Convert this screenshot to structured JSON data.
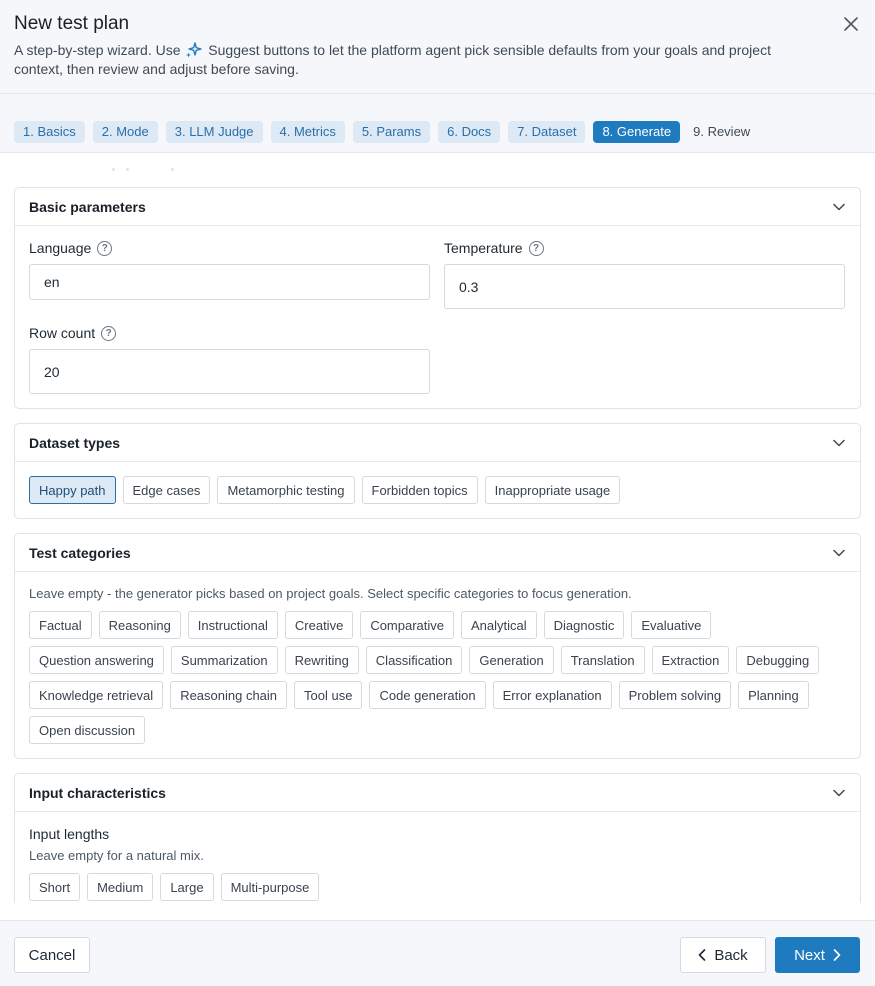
{
  "dialog": {
    "title": "New test plan",
    "subtitle_before": "A step-by-step wizard. Use",
    "subtitle_after": "Suggest buttons to let the platform agent pick sensible defaults from your goals and project context, then review and adjust before saving.",
    "sparkle_icon": "sparkle-icon",
    "close_icon": "close-icon"
  },
  "steps": [
    {
      "label": "1. Basics",
      "state": "done"
    },
    {
      "label": "2. Mode",
      "state": "done"
    },
    {
      "label": "3. LLM Judge",
      "state": "done"
    },
    {
      "label": "4. Metrics",
      "state": "done"
    },
    {
      "label": "5. Params",
      "state": "done"
    },
    {
      "label": "6. Docs",
      "state": "done"
    },
    {
      "label": "7. Dataset",
      "state": "done"
    },
    {
      "label": "8. Generate",
      "state": "active"
    },
    {
      "label": "9. Review",
      "state": "todo"
    }
  ],
  "basic": {
    "title": "Basic parameters",
    "language_label": "Language",
    "language_value": "en",
    "temperature_label": "Temperature",
    "temperature_value": "0.3",
    "rowcount_label": "Row count",
    "rowcount_value": "20",
    "help_glyph": "?"
  },
  "dataset_types": {
    "title": "Dataset types",
    "items": [
      {
        "label": "Happy path",
        "selected": true
      },
      {
        "label": "Edge cases",
        "selected": false
      },
      {
        "label": "Metamorphic testing",
        "selected": false
      },
      {
        "label": "Forbidden topics",
        "selected": false
      },
      {
        "label": "Inappropriate usage",
        "selected": false
      }
    ]
  },
  "test_categories": {
    "title": "Test categories",
    "hint": "Leave empty - the generator picks based on project goals. Select specific categories to focus generation.",
    "items": [
      "Factual",
      "Reasoning",
      "Instructional",
      "Creative",
      "Comparative",
      "Analytical",
      "Diagnostic",
      "Evaluative",
      "Question answering",
      "Summarization",
      "Rewriting",
      "Classification",
      "Generation",
      "Translation",
      "Extraction",
      "Debugging",
      "Knowledge retrieval",
      "Reasoning chain",
      "Tool use",
      "Code generation",
      "Error explanation",
      "Problem solving",
      "Planning",
      "Open discussion"
    ]
  },
  "input_characteristics": {
    "title": "Input characteristics",
    "lengths_label": "Input lengths",
    "lengths_hint": "Leave empty for a natural mix.",
    "lengths": [
      "Short",
      "Medium",
      "Large",
      "Multi-purpose"
    ]
  },
  "footer": {
    "cancel": "Cancel",
    "back": "Back",
    "next": "Next"
  },
  "colors": {
    "accent": "#1f7bc0",
    "step_done_bg": "#dde9f4",
    "header_bg": "#f5f7fa"
  }
}
